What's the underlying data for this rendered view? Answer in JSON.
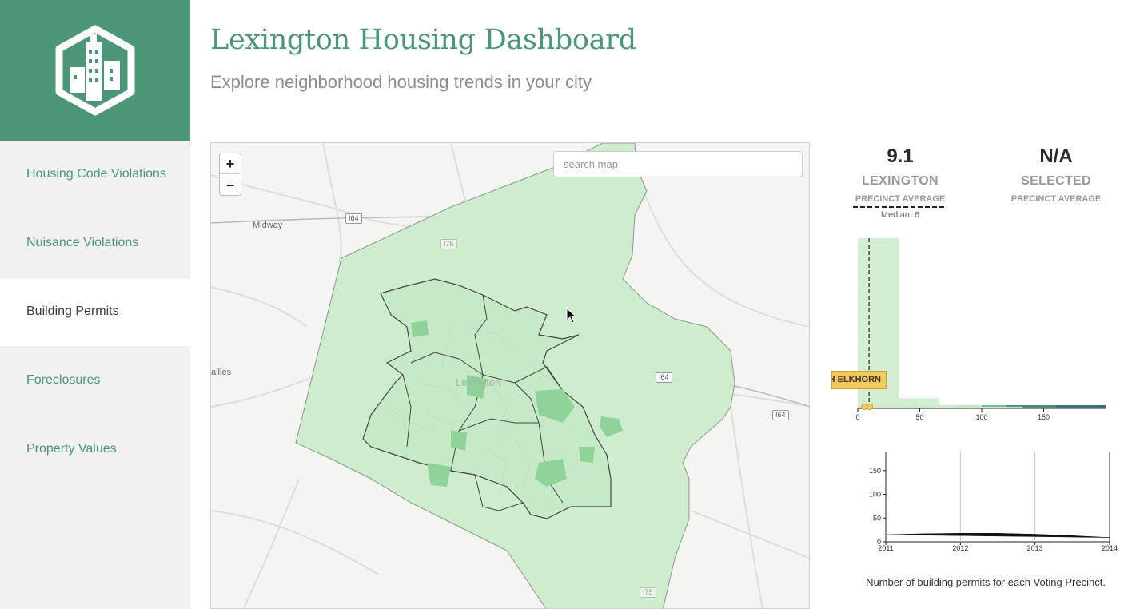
{
  "app": {
    "title": "Lexington Housing Dashboard",
    "subtitle": "Explore neighborhood housing trends in your city"
  },
  "sidebar": {
    "items": [
      {
        "label": "Housing Code Violations",
        "active": false
      },
      {
        "label": "Nuisance Violations",
        "active": false
      },
      {
        "label": "Building Permits",
        "active": true
      },
      {
        "label": "Foreclosures",
        "active": false
      },
      {
        "label": "Property Values",
        "active": false
      }
    ]
  },
  "map": {
    "zoom_in": "+",
    "zoom_out": "−",
    "search_placeholder": "search map",
    "place_labels": [
      "Midway",
      "ailles",
      "Lexington"
    ],
    "road_shields": [
      "I64",
      "I75",
      "I64",
      "I64",
      "I75"
    ],
    "tooltip": "NORTH ELKHORN"
  },
  "stats": {
    "lexington": {
      "value": "9.1",
      "name": "LEXINGTON",
      "sub": "PRECINCT AVERAGE",
      "median": "Median: 6"
    },
    "selected": {
      "value": "N/A",
      "name": "SELECTED",
      "sub": "PRECINCT AVERAGE"
    }
  },
  "colors": {
    "brand": "#4a9676",
    "map_fill": "#cfeccf",
    "map_fill_dark": "#8fd39b",
    "tooltip": "#f5c85c"
  },
  "chart_data": [
    {
      "type": "bar",
      "title": "",
      "xlabel": "",
      "ylabel": "",
      "x_ticks": [
        0,
        50,
        100,
        150
      ],
      "xlim": [
        0,
        200
      ],
      "bins": [
        {
          "x0": 0,
          "x1": 33,
          "count": 100
        },
        {
          "x0": 33,
          "x1": 66,
          "count": 6
        },
        {
          "x0": 66,
          "x1": 100,
          "count": 2
        },
        {
          "x0": 100,
          "x1": 133,
          "count": 1
        },
        {
          "x0": 133,
          "x1": 166,
          "count": 0
        },
        {
          "x0": 166,
          "x1": 200,
          "count": 0
        }
      ],
      "mean_marker": 9.1,
      "median": 6,
      "color_scale": [
        "#cfeccf",
        "#a8dfb0",
        "#6fb58d",
        "#4a8a7a",
        "#3a6f74"
      ]
    },
    {
      "type": "area",
      "title": "",
      "caption": "Number of building permits for each Voting Precinct.",
      "x_ticks": [
        "2011",
        "2012",
        "2013",
        "2014"
      ],
      "y_ticks": [
        0,
        50,
        100,
        150
      ],
      "ylim": [
        0,
        190
      ],
      "xlim": [
        2011,
        2014
      ],
      "x": [
        2011,
        2011.5,
        2012,
        2012.5,
        2013,
        2013.5,
        2014
      ],
      "upper": [
        15,
        17,
        18,
        18,
        16,
        13,
        9
      ],
      "lower": [
        14,
        14,
        13,
        12,
        11,
        10,
        9
      ]
    }
  ]
}
